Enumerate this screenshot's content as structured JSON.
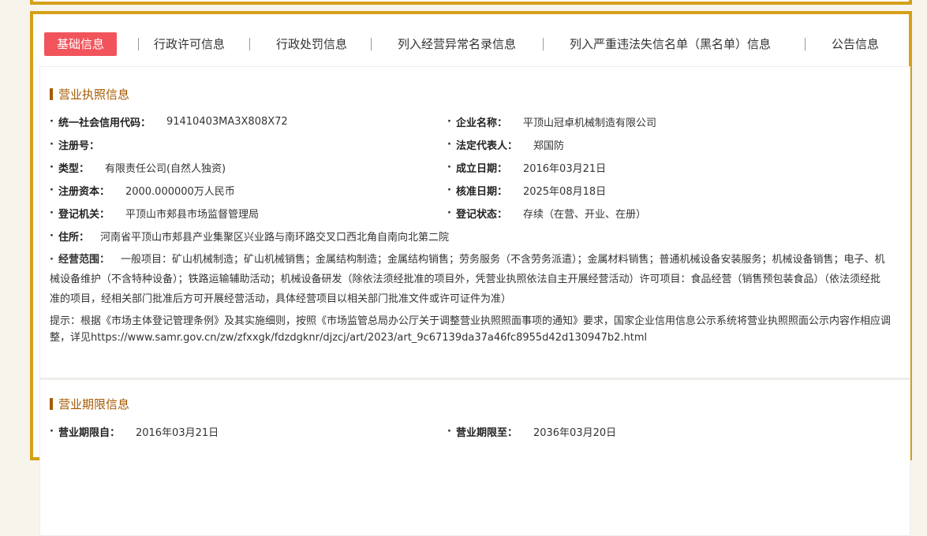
{
  "tabs": [
    "基础信息",
    "行政许可信息",
    "行政处罚信息",
    "列入经营异常名录信息",
    "列入严重违法失信名单（黑名单）信息",
    "公告信息"
  ],
  "license_section": {
    "title": "营业执照信息",
    "fields": {
      "credit_code_label": "统一社会信用代码：",
      "credit_code": "91410403MA3X808X72",
      "company_name_label": "企业名称：",
      "company_name": "平顶山冠卓机械制造有限公司",
      "reg_no_label": "注册号：",
      "reg_no": "",
      "legal_rep_label": "法定代表人：",
      "legal_rep": "郑国防",
      "type_label": "类型：",
      "type": "有限责任公司(自然人独资)",
      "founded_label": "成立日期：",
      "founded": "2016年03月21日",
      "capital_label": "注册资本：",
      "capital": "2000.000000万人民币",
      "approved_label": "核准日期：",
      "approved": "2025年08月18日",
      "authority_label": "登记机关：",
      "authority": "平顶山市郏县市场监督管理局",
      "status_label": "登记状态：",
      "status": "存续（在营、开业、在册）",
      "address_label": "住所：",
      "address": "河南省平顶山市郏县产业集聚区兴业路与南环路交叉口西北角自南向北第二院",
      "scope_label": "经营范围：",
      "scope": "一般项目：矿山机械制造；矿山机械销售；金属结构制造；金属结构销售；劳务服务（不含劳务派遣）；金属材料销售；普通机械设备安装服务；机械设备销售；电子、机械设备维护（不含特种设备）；铁路运输辅助活动；机械设备研发（除依法须经批准的项目外，凭营业执照依法自主开展经营活动）许可项目：食品经营（销售预包装食品）（依法须经批准的项目，经相关部门批准后方可开展经营活动，具体经营项目以相关部门批准文件或许可证件为准）"
    },
    "notice": "提示：根据《市场主体登记管理条例》及其实施细则，按照《市场监管总局办公厅关于调整营业执照照面事项的通知》要求，国家企业信用信息公示系统将营业执照照面公示内容作相应调整，详见https://www.samr.gov.cn/zw/zfxxgk/fdzdgknr/djzcj/art/2023/art_9c67139da37a46fc8955d42d130947b2.html"
  },
  "term_section": {
    "title": "营业期限信息",
    "from_label": "营业期限自：",
    "from": "2016年03月21日",
    "to_label": "营业期限至：",
    "to": "2036年03月20日"
  },
  "colors": {
    "frame": "#d4a017",
    "active_tab": "#f2545b",
    "section_title": "#a65a00"
  }
}
